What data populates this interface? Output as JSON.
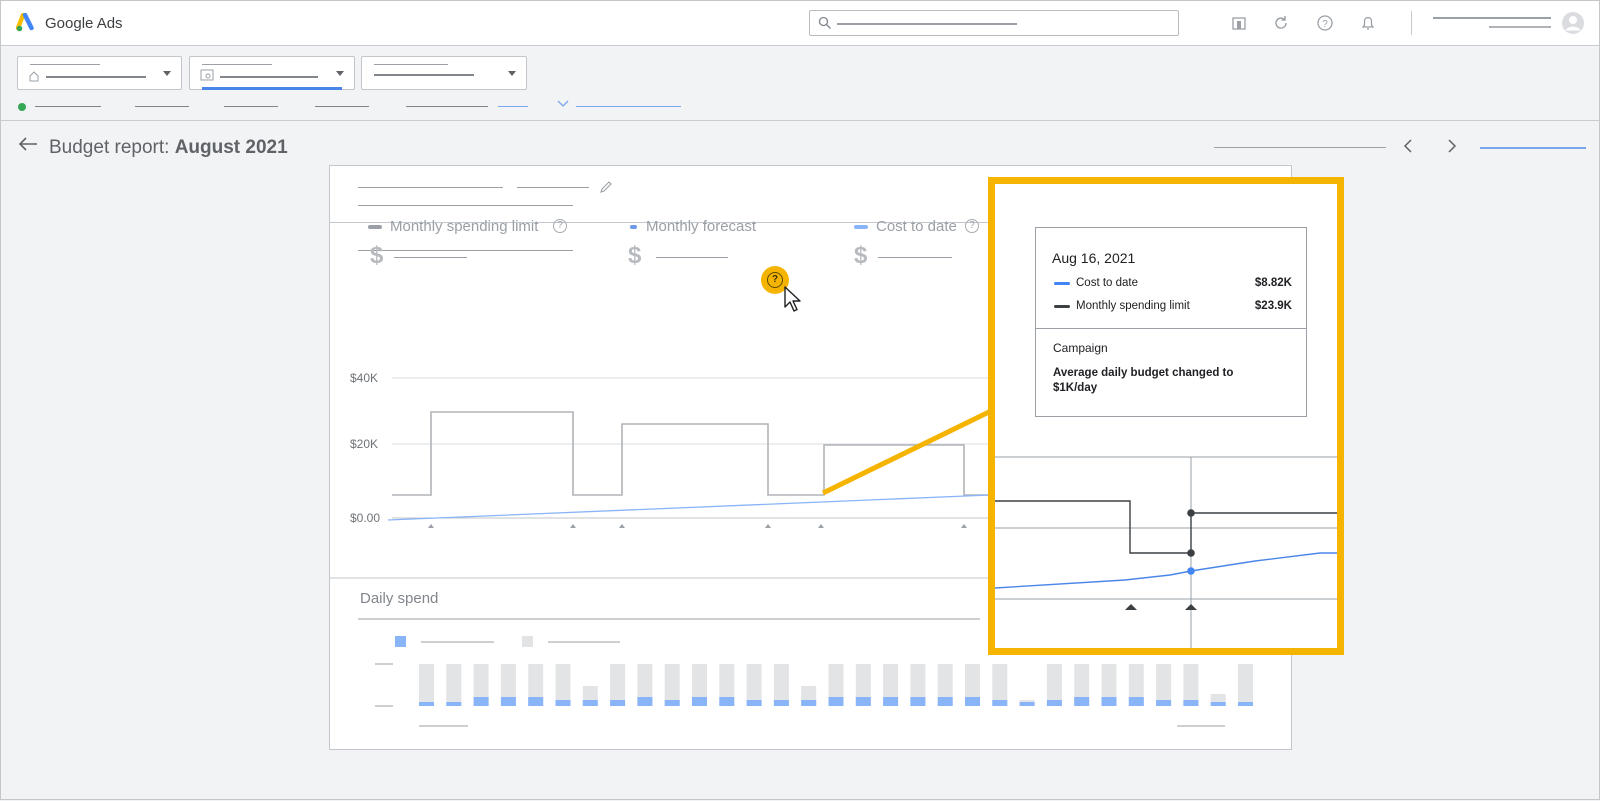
{
  "app": {
    "brand": "Google Ads"
  },
  "page": {
    "title_prefix": "Budget report: ",
    "title_bold": "August 2021"
  },
  "metrics": [
    {
      "label": "Monthly spending limit",
      "currency": "$",
      "color": "#9aa0a6"
    },
    {
      "label": "Monthly forecast",
      "currency": "$",
      "color": "#6f9ae8"
    },
    {
      "label": "Cost to date",
      "currency": "$",
      "color": "#8ab4f8"
    }
  ],
  "chart": {
    "y_labels": [
      "$40K",
      "$20K",
      "$0.00"
    ],
    "section_label": "Daily spend"
  },
  "tooltip": {
    "date": "Aug 16, 2021",
    "rows": [
      {
        "name": "Cost to date",
        "value": "$8.82K",
        "color": "#4285f4"
      },
      {
        "name": "Monthly spending limit",
        "value": "$23.9K",
        "color": "#3c4043"
      }
    ],
    "section": "Campaign",
    "message": "Average daily budget changed to $1K/day"
  },
  "colors": {
    "accent": "#f4b400",
    "blue": "#4285f4"
  },
  "icons": [
    "search-icon",
    "chart-icon",
    "refresh-icon",
    "help-icon",
    "bell-icon",
    "avatar-icon",
    "back-arrow-icon",
    "pencil-icon",
    "chevron-left-icon",
    "chevron-right-icon"
  ]
}
